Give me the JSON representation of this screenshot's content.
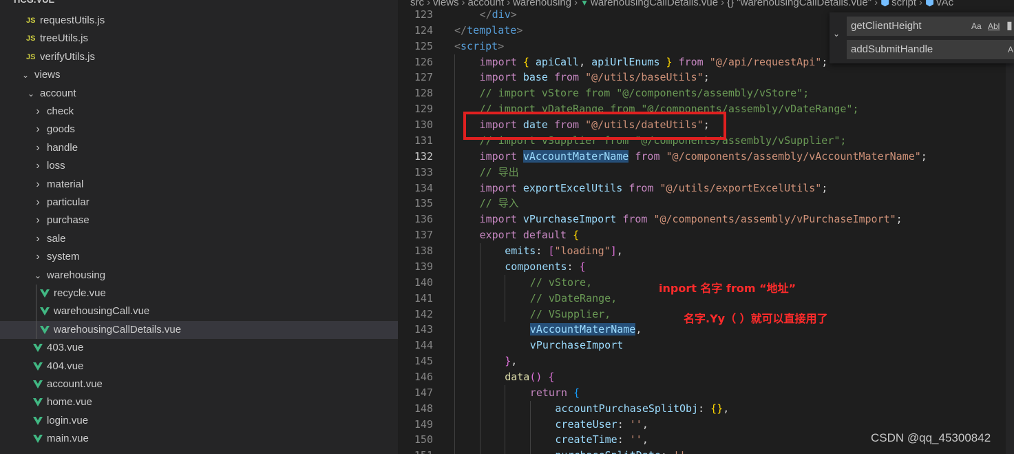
{
  "sidebar": {
    "header": "HCG.VUE",
    "items": [
      {
        "label": "requestUtils.js",
        "kind": "js",
        "depth": 2
      },
      {
        "label": "treeUtils.js",
        "kind": "js",
        "depth": 2
      },
      {
        "label": "verifyUtils.js",
        "kind": "js",
        "depth": 2
      },
      {
        "label": "views",
        "kind": "folder-open",
        "depth": 1
      },
      {
        "label": "account",
        "kind": "folder-open",
        "depth": 2
      },
      {
        "label": "check",
        "kind": "folder",
        "depth": 3
      },
      {
        "label": "goods",
        "kind": "folder",
        "depth": 3
      },
      {
        "label": "handle",
        "kind": "folder",
        "depth": 3
      },
      {
        "label": "loss",
        "kind": "folder",
        "depth": 3
      },
      {
        "label": "material",
        "kind": "folder",
        "depth": 3
      },
      {
        "label": "particular",
        "kind": "folder",
        "depth": 3
      },
      {
        "label": "purchase",
        "kind": "folder",
        "depth": 3
      },
      {
        "label": "sale",
        "kind": "folder",
        "depth": 3
      },
      {
        "label": "system",
        "kind": "folder",
        "depth": 3
      },
      {
        "label": "warehousing",
        "kind": "folder-open",
        "depth": 3
      },
      {
        "label": "recycle.vue",
        "kind": "vue",
        "depth": 4
      },
      {
        "label": "warehousingCall.vue",
        "kind": "vue",
        "depth": 4
      },
      {
        "label": "warehousingCallDetails.vue",
        "kind": "vue",
        "depth": 4,
        "selected": true
      },
      {
        "label": "403.vue",
        "kind": "vue",
        "depth": 3
      },
      {
        "label": "404.vue",
        "kind": "vue",
        "depth": 3
      },
      {
        "label": "account.vue",
        "kind": "vue",
        "depth": 3
      },
      {
        "label": "home.vue",
        "kind": "vue",
        "depth": 3
      },
      {
        "label": "login.vue",
        "kind": "vue",
        "depth": 3
      },
      {
        "label": "main.vue",
        "kind": "vue",
        "depth": 3
      }
    ]
  },
  "breadcrumb": {
    "items": [
      "src",
      "views",
      "account",
      "warehousing",
      "warehousingCallDetails.vue",
      "{} \"warehousingCallDetails.vue\"",
      "script",
      "vAc"
    ]
  },
  "find_widget": {
    "find_value": "getClientHeight",
    "replace_value": "addSubmitHandle",
    "opt_case": "Aa",
    "opt_word": "Abl",
    "opt_preserve": "A"
  },
  "editor": {
    "current_line": 132,
    "lines": [
      {
        "n": "123",
        "indent": 1,
        "tokens": [
          [
            "tag",
            "</"
          ],
          [
            "tagn",
            "div"
          ],
          [
            "tag",
            ">"
          ]
        ]
      },
      {
        "n": "124",
        "indent": 0,
        "tokens": [
          [
            "tag",
            "</"
          ],
          [
            "tagn",
            "template"
          ],
          [
            "tag",
            ">"
          ]
        ]
      },
      {
        "n": "125",
        "indent": 0,
        "tokens": [
          [
            "tag",
            "<"
          ],
          [
            "tagn",
            "script"
          ],
          [
            "tag",
            ">"
          ]
        ]
      },
      {
        "n": "126",
        "indent": 1,
        "tokens": [
          [
            "kw",
            "import"
          ],
          [
            "pun",
            " "
          ],
          [
            "br1",
            "{"
          ],
          [
            "pun",
            " "
          ],
          [
            "var",
            "apiCall"
          ],
          [
            "pun",
            ", "
          ],
          [
            "var",
            "apiUrlEnums"
          ],
          [
            "pun",
            " "
          ],
          [
            "br1",
            "}"
          ],
          [
            "pun",
            " "
          ],
          [
            "kw",
            "from"
          ],
          [
            "pun",
            " "
          ],
          [
            "str",
            "\"@/api/requestApi\""
          ],
          [
            "pun",
            ";"
          ]
        ]
      },
      {
        "n": "127",
        "indent": 1,
        "tokens": [
          [
            "kw",
            "import"
          ],
          [
            "pun",
            " "
          ],
          [
            "var",
            "base"
          ],
          [
            "pun",
            " "
          ],
          [
            "kw",
            "from"
          ],
          [
            "pun",
            " "
          ],
          [
            "str",
            "\"@/utils/baseUtils\""
          ],
          [
            "pun",
            ";"
          ]
        ]
      },
      {
        "n": "128",
        "indent": 1,
        "tokens": [
          [
            "com",
            "// import vStore from \"@/components/assembly/vStore\";"
          ]
        ]
      },
      {
        "n": "129",
        "indent": 1,
        "tokens": [
          [
            "com",
            "// import vDateRange from \"@/components/assembly/vDateRange\";"
          ]
        ]
      },
      {
        "n": "130",
        "indent": 1,
        "tokens": [
          [
            "kw",
            "import"
          ],
          [
            "pun",
            " "
          ],
          [
            "var",
            "date"
          ],
          [
            "pun",
            " "
          ],
          [
            "kw",
            "from"
          ],
          [
            "pun",
            " "
          ],
          [
            "str",
            "\"@/utils/dateUtils\""
          ],
          [
            "pun",
            ";"
          ]
        ]
      },
      {
        "n": "131",
        "indent": 1,
        "tokens": [
          [
            "com",
            "// import vSupplier from \"@/components/assembly/vSupplier\";"
          ]
        ]
      },
      {
        "n": "132",
        "indent": 1,
        "tokens": [
          [
            "kw",
            "import"
          ],
          [
            "pun",
            " "
          ],
          [
            "var hl",
            "vAccountMaterName"
          ],
          [
            "pun",
            " "
          ],
          [
            "kw",
            "from"
          ],
          [
            "pun",
            " "
          ],
          [
            "str",
            "\"@/components/assembly/vAccountMaterName\""
          ],
          [
            "pun",
            ";"
          ]
        ]
      },
      {
        "n": "133",
        "indent": 1,
        "tokens": [
          [
            "com",
            "// 导出"
          ]
        ]
      },
      {
        "n": "134",
        "indent": 1,
        "tokens": [
          [
            "kw",
            "import"
          ],
          [
            "pun",
            " "
          ],
          [
            "var",
            "exportExcelUtils"
          ],
          [
            "pun",
            " "
          ],
          [
            "kw",
            "from"
          ],
          [
            "pun",
            " "
          ],
          [
            "str",
            "\"@/utils/exportExcelUtils\""
          ],
          [
            "pun",
            ";"
          ]
        ]
      },
      {
        "n": "135",
        "indent": 1,
        "tokens": [
          [
            "com",
            "// 导入"
          ]
        ]
      },
      {
        "n": "136",
        "indent": 1,
        "tokens": [
          [
            "kw",
            "import"
          ],
          [
            "pun",
            " "
          ],
          [
            "var",
            "vPurchaseImport"
          ],
          [
            "pun",
            " "
          ],
          [
            "kw",
            "from"
          ],
          [
            "pun",
            " "
          ],
          [
            "str",
            "\"@/components/assembly/vPurchaseImport\""
          ],
          [
            "pun",
            ";"
          ]
        ]
      },
      {
        "n": "137",
        "indent": 1,
        "tokens": [
          [
            "kw",
            "export"
          ],
          [
            "pun",
            " "
          ],
          [
            "kw",
            "default"
          ],
          [
            "pun",
            " "
          ],
          [
            "br1",
            "{"
          ]
        ]
      },
      {
        "n": "138",
        "indent": 2,
        "tokens": [
          [
            "var",
            "emits"
          ],
          [
            "pun",
            ": "
          ],
          [
            "br2",
            "["
          ],
          [
            "str",
            "\"loading\""
          ],
          [
            "br2",
            "]"
          ],
          [
            "pun",
            ","
          ]
        ]
      },
      {
        "n": "139",
        "indent": 2,
        "tokens": [
          [
            "var",
            "components"
          ],
          [
            "pun",
            ": "
          ],
          [
            "br2",
            "{"
          ]
        ]
      },
      {
        "n": "140",
        "indent": 3,
        "tokens": [
          [
            "com",
            "// vStore,"
          ]
        ]
      },
      {
        "n": "141",
        "indent": 3,
        "tokens": [
          [
            "com",
            "// vDateRange,"
          ]
        ]
      },
      {
        "n": "142",
        "indent": 3,
        "tokens": [
          [
            "com",
            "// VSupplier,"
          ]
        ]
      },
      {
        "n": "143",
        "indent": 3,
        "tokens": [
          [
            "var hl",
            "vAccountMaterName"
          ],
          [
            "pun",
            ","
          ]
        ]
      },
      {
        "n": "144",
        "indent": 3,
        "tokens": [
          [
            "var",
            "vPurchaseImport"
          ]
        ]
      },
      {
        "n": "145",
        "indent": 2,
        "tokens": [
          [
            "br2",
            "}"
          ],
          [
            "pun",
            ","
          ]
        ]
      },
      {
        "n": "146",
        "indent": 2,
        "tokens": [
          [
            "fn",
            "data"
          ],
          [
            "br2",
            "("
          ],
          [
            "br2",
            ")"
          ],
          [
            "pun",
            " "
          ],
          [
            "br2",
            "{"
          ]
        ]
      },
      {
        "n": "147",
        "indent": 3,
        "tokens": [
          [
            "kw",
            "return"
          ],
          [
            "pun",
            " "
          ],
          [
            "br3",
            "{"
          ]
        ]
      },
      {
        "n": "148",
        "indent": 4,
        "tokens": [
          [
            "var",
            "accountPurchaseSplitObj"
          ],
          [
            "pun",
            ": "
          ],
          [
            "br1",
            "{}"
          ],
          [
            "pun",
            ","
          ]
        ]
      },
      {
        "n": "149",
        "indent": 4,
        "tokens": [
          [
            "var",
            "createUser"
          ],
          [
            "pun",
            ": "
          ],
          [
            "str",
            "''"
          ],
          [
            "pun",
            ","
          ]
        ]
      },
      {
        "n": "150",
        "indent": 4,
        "tokens": [
          [
            "var",
            "createTime"
          ],
          [
            "pun",
            ": "
          ],
          [
            "str",
            "''"
          ],
          [
            "pun",
            ","
          ]
        ]
      },
      {
        "n": "151",
        "indent": 4,
        "tokens": [
          [
            "var",
            "purchaseSplitDate"
          ],
          [
            "pun",
            ": "
          ],
          [
            "str",
            "''"
          ]
        ]
      }
    ]
  },
  "annotations": {
    "line1": "inport 名字 from “地址”",
    "line2": "名字.Yy（ ）就可以直接用了"
  },
  "watermark": "CSDN @qq_45300842",
  "colors": {
    "editor_bg": "#1e1e1e",
    "sidebar_bg": "#252526",
    "highlight_box": "#e02020",
    "annotation": "#ff2b2b",
    "vue_icon": "#41b883",
    "js_icon": "#cbcb41"
  }
}
